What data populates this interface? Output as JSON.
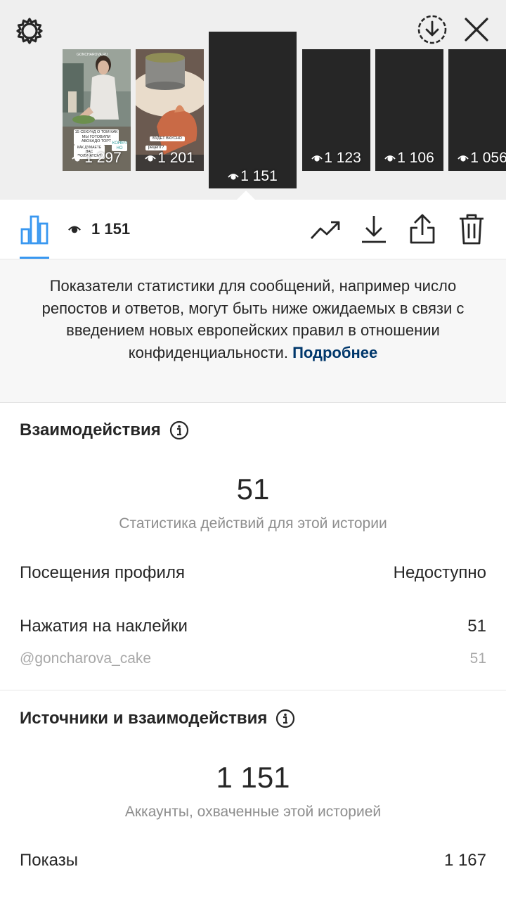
{
  "top": {
    "thumbnails": [
      {
        "views": "1 297",
        "caption_main": "15 СЕКУНД О ТОМ КАК МЫ ГОТОВИЛИ АВОКАДО ТОРТ",
        "caption_q": "КАК ДУМАЕТЕ НАС ПОЛУЧАТСЯ?",
        "caption_sticker": "КОНЕЧ НО"
      },
      {
        "views": "1 201",
        "caption_main": "БУДЕТ ВКУСНО",
        "caption_sticker": "рецепт?"
      },
      {
        "views": "1 151"
      },
      {
        "views": "1 123"
      },
      {
        "views": "1 106"
      },
      {
        "views": "1 056"
      }
    ]
  },
  "toolbar": {
    "views": "1 151"
  },
  "notice": {
    "text": "Показатели статистики для сообщений, например число репостов и ответов, могут быть ниже ожидаемых в связи с введением новых европейских правил в отношении конфиденциальности.",
    "link": "Подробнее"
  },
  "interactions": {
    "title": "Взаимодействия",
    "total": "51",
    "subtitle": "Статистика действий для этой истории",
    "profile_visits_label": "Посещения профиля",
    "profile_visits_value": "Недоступно",
    "sticker_taps_label": "Нажатия на наклейки",
    "sticker_taps_value": "51",
    "sticker_handle": "@goncharova_cake",
    "sticker_handle_value": "51"
  },
  "discovery": {
    "title": "Источники и взаимодействия",
    "total": "1 151",
    "subtitle": "Аккаунты, охваченные этой историей",
    "impressions_label": "Показы",
    "impressions_value": "1 167"
  },
  "colors": {
    "accent": "#3897f0",
    "link": "#00376b",
    "text": "#262626",
    "muted": "#8e8e8e"
  }
}
